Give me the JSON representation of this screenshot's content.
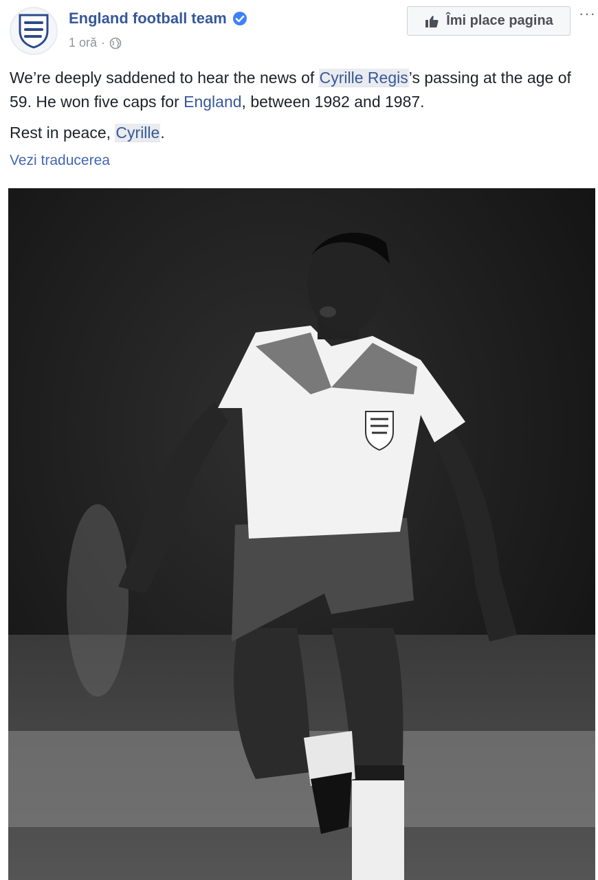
{
  "post": {
    "page_name": "England football team",
    "timestamp": "1 oră",
    "separator": "·",
    "like_page_label": "Îmi place pagina",
    "more_label": "···",
    "text": {
      "p1_a": "We’re deeply saddened to hear the news of ",
      "p1_mention": "Cyrille Regis",
      "p1_b": "’s passing at the age of 59. He won five caps for ",
      "p1_page": "England",
      "p1_c": ", between 1982 and 1987.",
      "p2_a": "Rest in peace, ",
      "p2_mention": "Cyrille",
      "p2_b": "."
    },
    "see_translation": "Vezi traducerea"
  },
  "icons": {
    "avatar": "three-lions-crest-icon",
    "verified": "verified-badge-icon",
    "privacy": "globe-icon",
    "like": "thumbs-up-icon",
    "more": "more-options-icon"
  },
  "colors": {
    "link": "#365899",
    "verified": "#4080ff",
    "meta": "#90949c"
  }
}
